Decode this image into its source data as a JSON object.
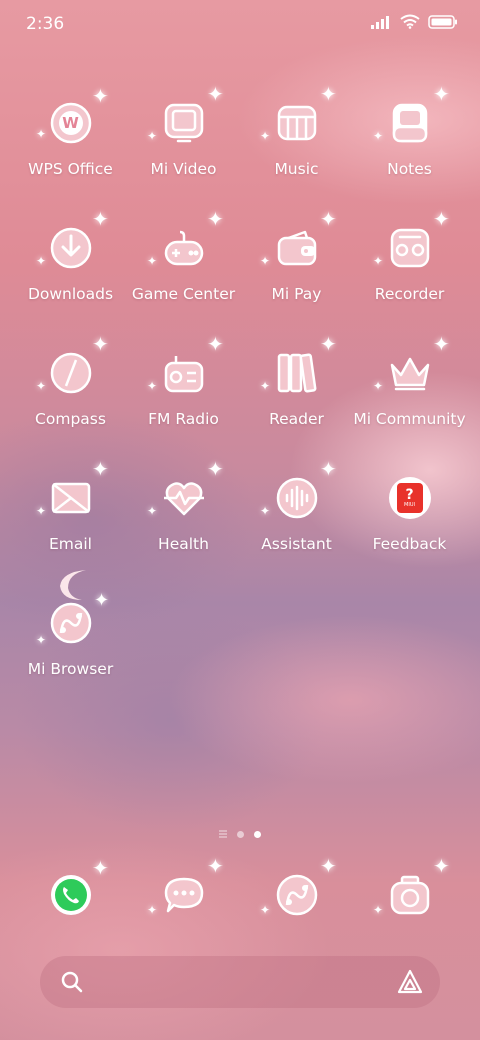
{
  "status_bar": {
    "time": "2:36"
  },
  "apps": [
    {
      "label": "WPS Office",
      "icon": "wps-office-icon"
    },
    {
      "label": "Mi Video",
      "icon": "mi-video-icon"
    },
    {
      "label": "Music",
      "icon": "music-icon"
    },
    {
      "label": "Notes",
      "icon": "notes-icon"
    },
    {
      "label": "Downloads",
      "icon": "downloads-icon"
    },
    {
      "label": "Game Center",
      "icon": "game-center-icon"
    },
    {
      "label": "Mi Pay",
      "icon": "mi-pay-icon"
    },
    {
      "label": "Recorder",
      "icon": "recorder-icon"
    },
    {
      "label": "Compass",
      "icon": "compass-icon"
    },
    {
      "label": "FM Radio",
      "icon": "fm-radio-icon"
    },
    {
      "label": "Reader",
      "icon": "reader-icon"
    },
    {
      "label": "Mi Community",
      "icon": "mi-community-icon"
    },
    {
      "label": "Email",
      "icon": "email-icon"
    },
    {
      "label": "Health",
      "icon": "health-icon"
    },
    {
      "label": "Assistant",
      "icon": "assistant-icon"
    },
    {
      "label": "Feedback",
      "icon": "feedback-icon"
    },
    {
      "label": "Mi Browser",
      "icon": "mi-browser-icon"
    }
  ],
  "feedback_icon_text": {
    "mark": "?",
    "badge": "MIUI"
  },
  "wps_letter": "W",
  "dock": [
    {
      "icon": "phone-icon"
    },
    {
      "icon": "messages-icon"
    },
    {
      "icon": "browser-icon"
    },
    {
      "icon": "camera-icon"
    }
  ],
  "colors": {
    "phone_green": "#2ecb5a",
    "feedback_red": "#e8322b",
    "icon_fill": "#f3c6cd"
  }
}
